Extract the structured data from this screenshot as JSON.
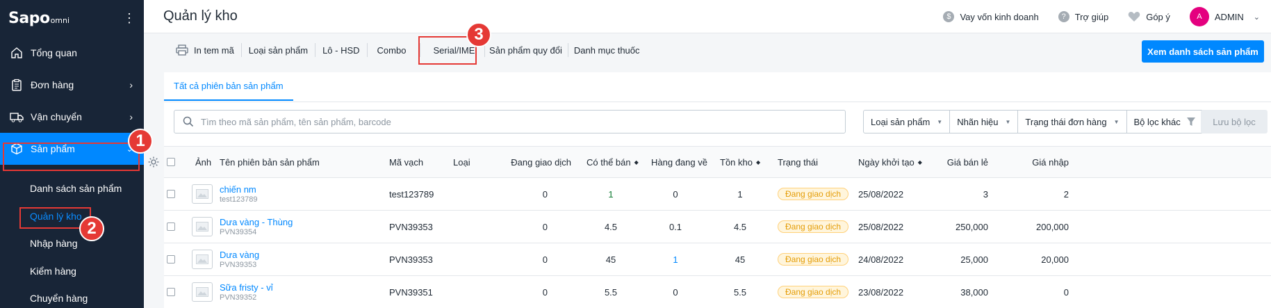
{
  "sidebar": {
    "logo_main": "Sapo",
    "logo_sub": "omni",
    "menu_icon": "more-vertical-icon",
    "items": [
      {
        "label": "Tổng quan",
        "icon": "home-icon"
      },
      {
        "label": "Đơn hàng",
        "icon": "clipboard-icon"
      },
      {
        "label": "Vận chuyển",
        "icon": "truck-icon"
      },
      {
        "label": "Sản phẩm",
        "icon": "box-icon"
      }
    ],
    "sub_items": [
      "Danh sách sản phẩm",
      "Quản lý kho",
      "Nhập hàng",
      "Kiểm hàng",
      "Chuyển hàng"
    ]
  },
  "header": {
    "title": "Quản lý kho",
    "loan": "Vay vốn kinh doanh",
    "help": "Trợ giúp",
    "feedback": "Góp ý",
    "avatar_letter": "A",
    "user": "ADMIN"
  },
  "toolbar": {
    "print": "In tem mã",
    "types": "Loại sản phẩm",
    "lot": "Lô - HSD",
    "combo": "Combo",
    "serial": "Serial/IMEI",
    "convert": "Sản phẩm quy đổi",
    "drug": "Danh mục thuốc",
    "primary": "Xem danh sách sản phẩm"
  },
  "tabs": [
    "Tất cả phiên bản sản phẩm"
  ],
  "search": {
    "placeholder": "Tìm theo mã sản phẩm, tên sản phẩm, barcode"
  },
  "filters": [
    "Loại sản phẩm",
    "Nhãn hiệu",
    "Trạng thái đơn hàng",
    "Bộ lọc khác"
  ],
  "save_filter": "Lưu bộ lọc",
  "table": {
    "headers": {
      "image": "Ảnh",
      "name": "Tên phiên bản sản phẩm",
      "barcode": "Mã vạch",
      "type": "Loại",
      "trading": "Đang giao dịch",
      "available": "Có thể bán",
      "incoming": "Hàng đang về",
      "stock": "Tồn kho",
      "status": "Trạng thái",
      "created": "Ngày khởi tạo",
      "retail": "Giá bán lẻ",
      "import": "Giá nhập"
    },
    "rows": [
      {
        "name": "chiến nm",
        "sku": "test123789",
        "barcode": "test123789",
        "type": "",
        "trading": "0",
        "available": "1",
        "incoming": "0",
        "stock": "1",
        "status": "Đang giao dịch",
        "created": "25/08/2022",
        "retail": "3",
        "import": "2"
      },
      {
        "name": "Dưa vàng - Thùng",
        "sku": "PVN39354",
        "barcode": "PVN39353",
        "type": "",
        "trading": "0",
        "available": "4.5",
        "incoming": "0.1",
        "stock": "4.5",
        "status": "Đang giao dịch",
        "created": "25/08/2022",
        "retail": "250,000",
        "import": "200,000"
      },
      {
        "name": "Dưa vàng",
        "sku": "PVN39353",
        "barcode": "PVN39353",
        "type": "",
        "trading": "0",
        "available": "45",
        "incoming": "1",
        "stock": "45",
        "status": "Đang giao dịch",
        "created": "24/08/2022",
        "retail": "25,000",
        "import": "20,000"
      },
      {
        "name": "Sữa fristy - vỉ",
        "sku": "PVN39352",
        "barcode": "PVN39351",
        "type": "",
        "trading": "0",
        "available": "5.5",
        "incoming": "0",
        "stock": "5.5",
        "status": "Đang giao dịch",
        "created": "23/08/2022",
        "retail": "38,000",
        "import": "0"
      }
    ]
  },
  "annotations": [
    "1",
    "2",
    "3"
  ],
  "colors": {
    "sidebar": "#182537",
    "accent": "#0088ff",
    "annotation": "#e53935",
    "badge": "#e49c06"
  }
}
